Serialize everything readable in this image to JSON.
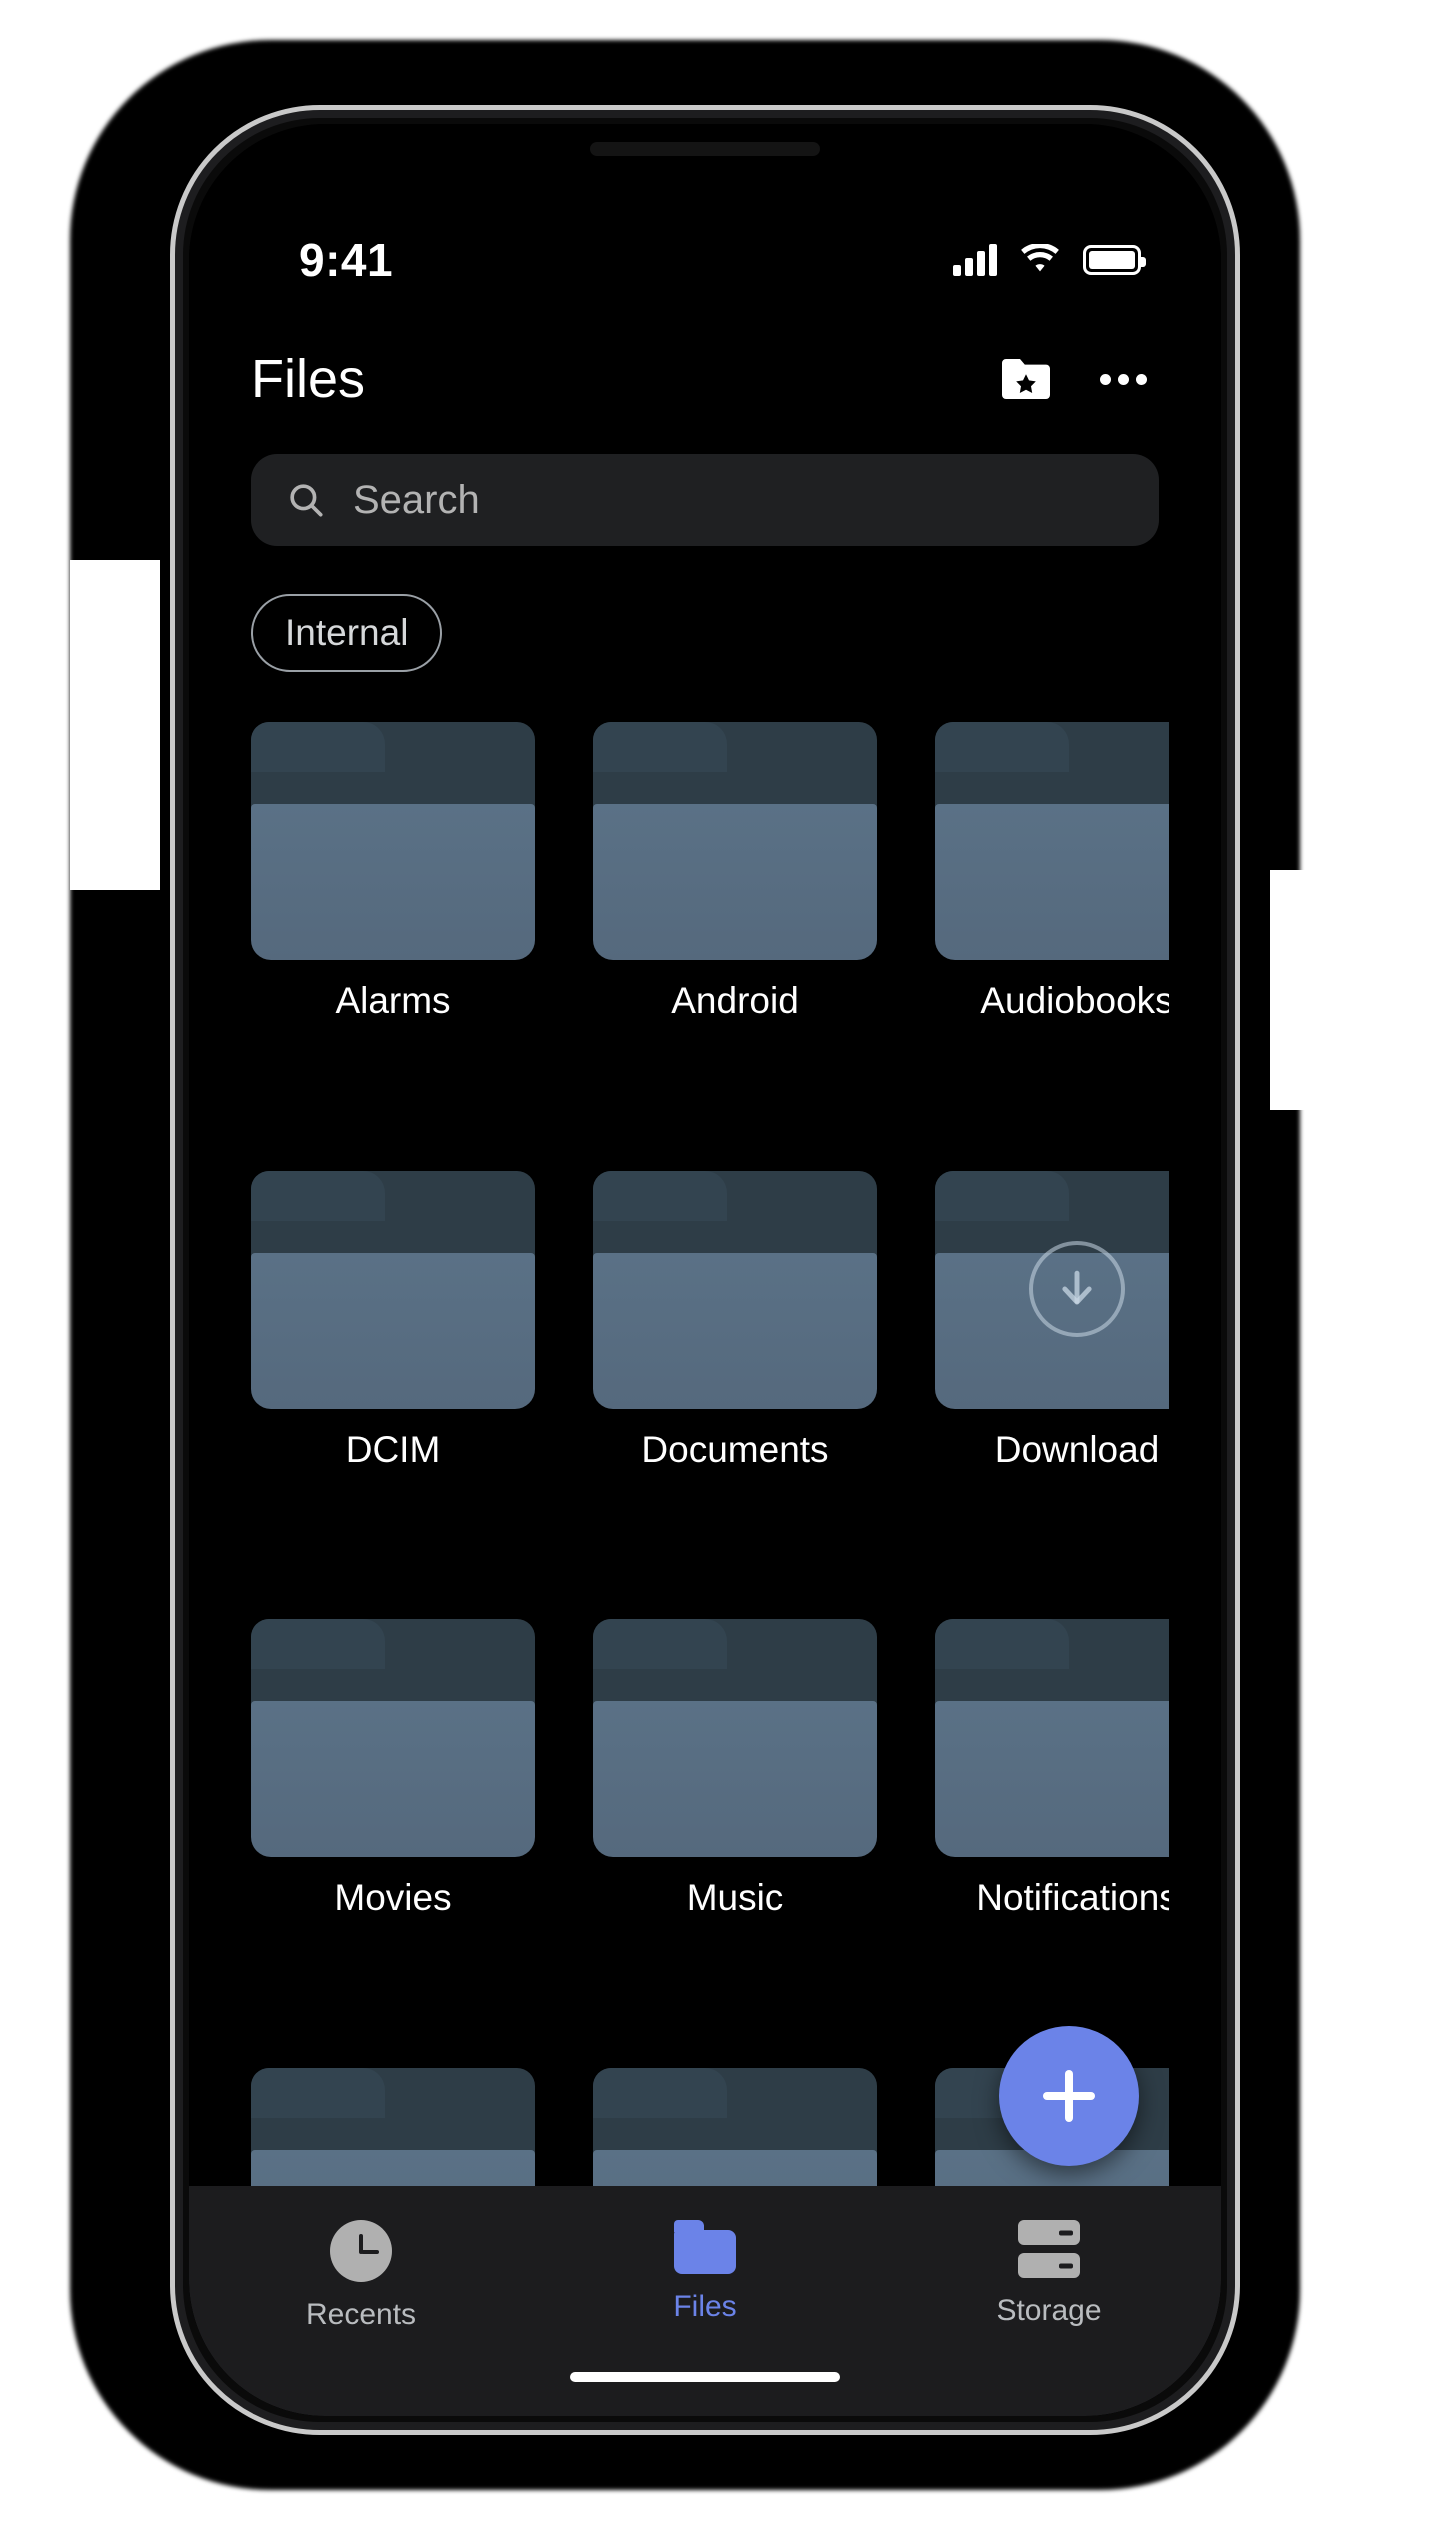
{
  "status_bar": {
    "time": "9:41",
    "signal_icon": "cellular-signal-icon",
    "wifi_icon": "wifi-icon",
    "battery_icon": "battery-icon"
  },
  "header": {
    "title": "Files",
    "favorites_icon": "folder-star-icon",
    "overflow_icon": "more-options-icon"
  },
  "search": {
    "placeholder": "Search",
    "value": "",
    "icon": "search-icon"
  },
  "chips": [
    {
      "label": "Internal",
      "selected": true
    }
  ],
  "folders": [
    {
      "label": "Alarms",
      "badge": null
    },
    {
      "label": "Android",
      "badge": null
    },
    {
      "label": "Audiobooks",
      "badge": null
    },
    {
      "label": "DCIM",
      "badge": null
    },
    {
      "label": "Documents",
      "badge": null
    },
    {
      "label": "Download",
      "badge": "download-arrow-icon"
    },
    {
      "label": "Movies",
      "badge": null
    },
    {
      "label": "Music",
      "badge": null
    },
    {
      "label": "Notifications",
      "badge": null
    },
    {
      "label": "",
      "badge": null
    },
    {
      "label": "",
      "badge": null
    },
    {
      "label": "",
      "badge": null
    }
  ],
  "fab": {
    "label": "+",
    "icon": "plus-icon",
    "color": "#6b83e8"
  },
  "bottom_nav": {
    "items": [
      {
        "label": "Recents",
        "icon": "clock-icon",
        "active": false
      },
      {
        "label": "Files",
        "icon": "folder-icon",
        "active": true
      },
      {
        "label": "Storage",
        "icon": "storage-icon",
        "active": false
      }
    ]
  },
  "colors": {
    "accent": "#6b83e8",
    "screen_background": "#000000",
    "nav_background": "#1c1c1e",
    "search_background": "#1f2022",
    "folder_tab": "#2e3d47",
    "folder_body": "#5a7186",
    "inactive_nav": "#b0b0b0"
  }
}
